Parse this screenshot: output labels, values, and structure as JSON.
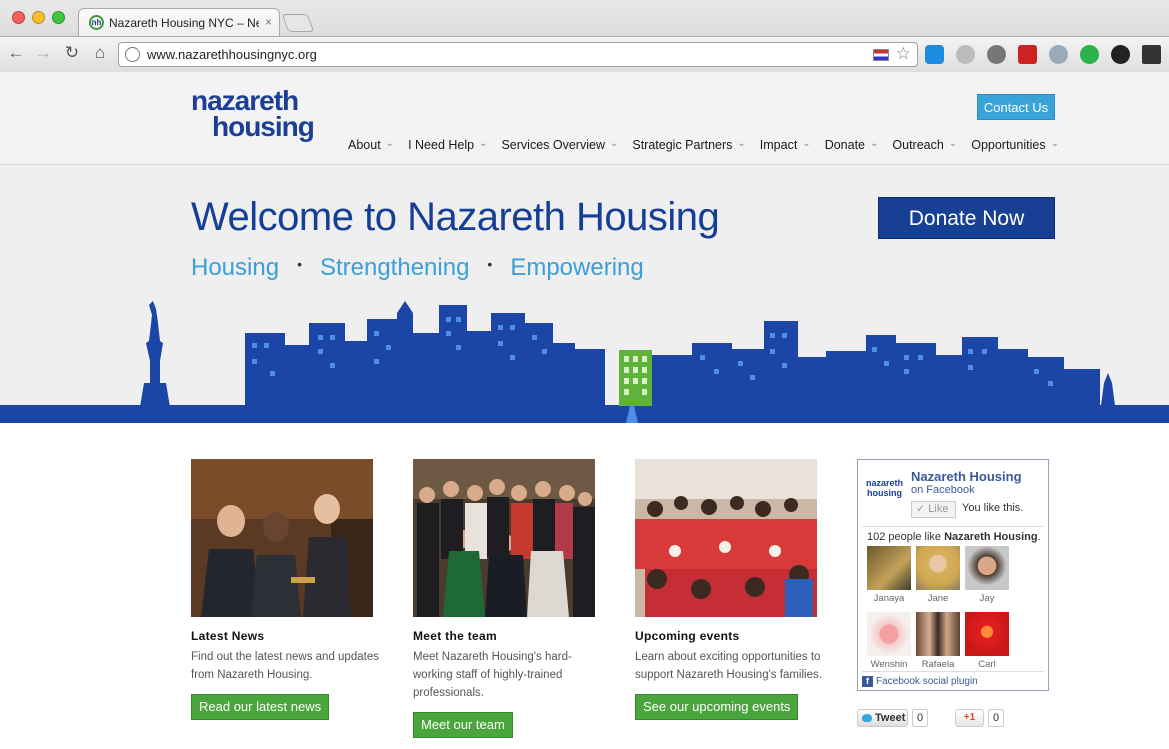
{
  "browser": {
    "tab_title": "Nazareth Housing NYC – New York",
    "tab_close": "×",
    "favicon_text": "nh",
    "url": "www.nazarethhousingnyc.org"
  },
  "header": {
    "logo_line1": "nazareth",
    "logo_line2": "housing",
    "contact_label": "Contact Us",
    "nav": [
      "About",
      "I Need Help",
      "Services Overview",
      "Strategic Partners",
      "Impact",
      "Donate",
      "Outreach",
      "Opportunities"
    ]
  },
  "hero": {
    "title": "Welcome to Nazareth Housing",
    "tagline": [
      "Housing",
      "Strengthening",
      "Empowering"
    ],
    "donate_label": "Donate Now"
  },
  "cards": [
    {
      "title": "Latest News",
      "desc": "Find out the latest news and updates from Nazareth Housing.",
      "button": "Read our latest news"
    },
    {
      "title": "Meet the team",
      "desc": "Meet Nazareth Housing's hard-working staff of highly-trained professionals.",
      "button": "Meet our team"
    },
    {
      "title": "Upcoming events",
      "desc": "Learn about exciting opportunities to support Nazareth Housing's families.",
      "button": "See our upcoming events"
    }
  ],
  "facebook": {
    "logo_line1": "nazareth",
    "logo_line2": "housing",
    "page_name": "Nazareth Housing",
    "subtitle": "on Facebook",
    "like_label": "Like",
    "you_like": "You like this.",
    "count_prefix": "102 people like",
    "count_page": "Nazareth Housing",
    "count_suffix": ".",
    "fans": [
      "Janaya",
      "Jane",
      "Jay",
      "Wenshin",
      "Rafaela",
      "Carl"
    ],
    "plugin_label": "Facebook social plugin"
  },
  "social": {
    "tweet_label": "Tweet",
    "tweet_count": "0",
    "gplus_label": "+1",
    "gplus_count": "0"
  },
  "colors": {
    "brand_blue": "#173f94",
    "accent_blue": "#3aa4d8",
    "button_green": "#4aa63c",
    "skyline_blue": "#1b46a8"
  }
}
